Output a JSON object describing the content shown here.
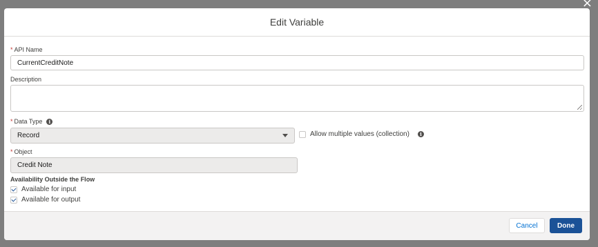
{
  "modal": {
    "title": "Edit Variable"
  },
  "fields": {
    "api_name": {
      "required_mark": "*",
      "label": "API Name",
      "value": "CurrentCreditNote"
    },
    "description": {
      "label": "Description",
      "value": ""
    },
    "data_type": {
      "required_mark": "*",
      "label": "Data Type",
      "info_icon": "info-icon",
      "value": "Record"
    },
    "allow_multiple": {
      "label": "Allow multiple values (collection)",
      "checked": false,
      "info_icon": "info-icon"
    },
    "object": {
      "required_mark": "*",
      "label": "Object",
      "value": "Credit Note"
    }
  },
  "availability": {
    "heading": "Availability Outside the Flow",
    "options": [
      {
        "label": "Available for input",
        "checked": true
      },
      {
        "label": "Available for output",
        "checked": true
      }
    ]
  },
  "footer": {
    "cancel_label": "Cancel",
    "done_label": "Done"
  },
  "colors": {
    "brand": "#1b5297",
    "link": "#0070d2",
    "required": "#c23934",
    "overlay": "#7e7e7e"
  }
}
